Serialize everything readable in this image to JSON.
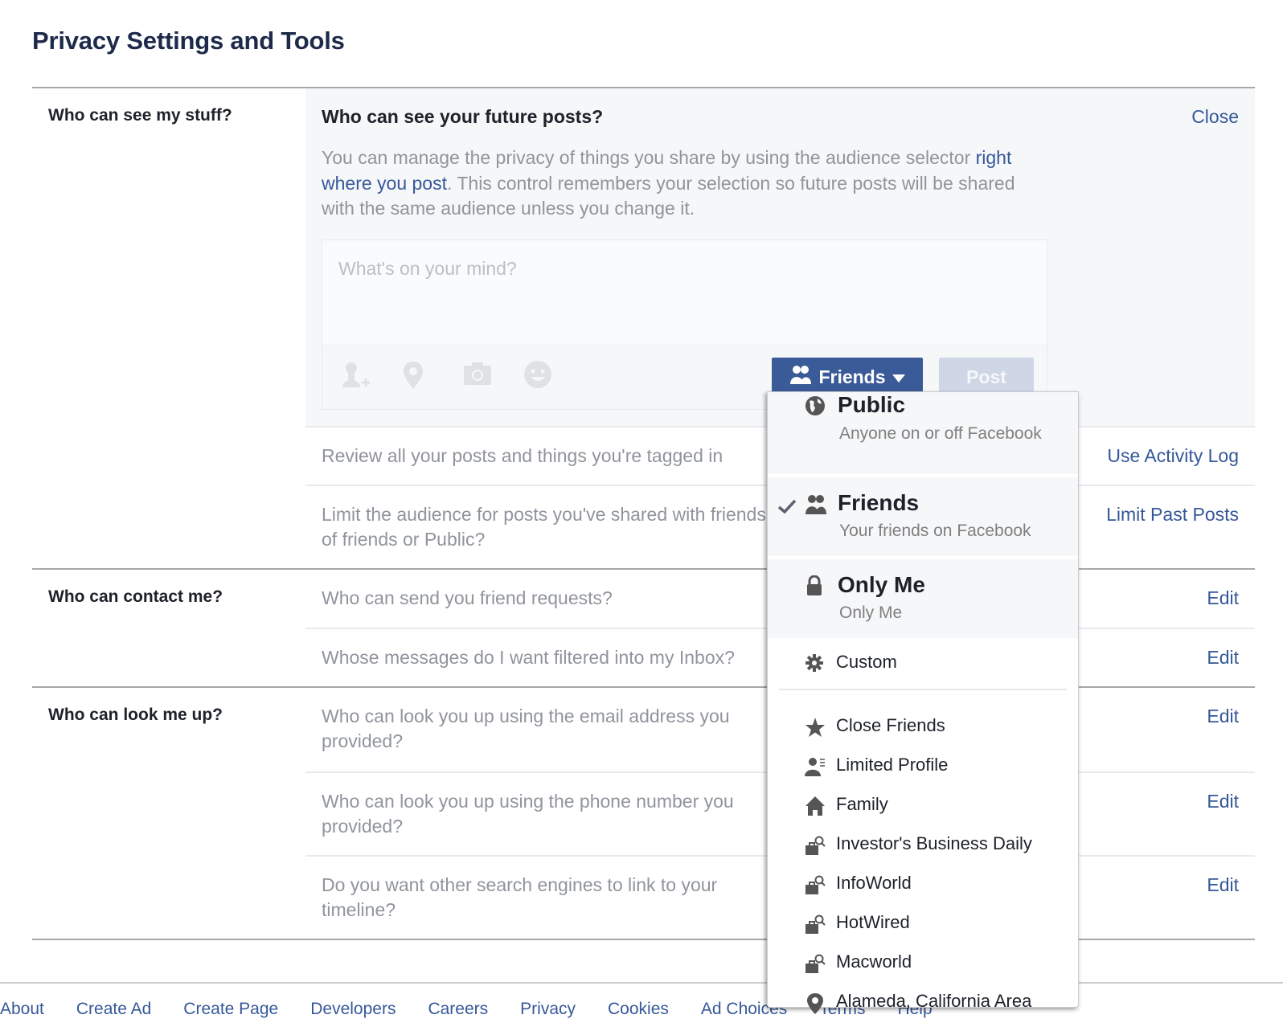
{
  "page": {
    "title": "Privacy Settings and Tools"
  },
  "colors": {
    "link": "#365899",
    "button": "#3b5a98",
    "muted_text": "#90949c",
    "panel_bg": "#f6f7f9"
  },
  "sections": [
    {
      "label": "Who can see my stuff?",
      "expanded": {
        "title": "Who can see your future posts?",
        "close_label": "Close",
        "description_before": "You can manage the privacy of things you share by using the audience selector ",
        "description_link": "right where you post",
        "description_after": ". This control remembers your selection so future posts will be shared with the same audience unless you change it.",
        "composer": {
          "placeholder": "What's on your mind?",
          "icons": [
            "tag-friends-icon",
            "location-pin-icon",
            "camera-icon",
            "smiley-icon"
          ],
          "audience_label": "Friends",
          "post_label": "Post"
        }
      },
      "rows": [
        {
          "text": "Review all your posts and things you're tagged in",
          "action": "Use Activity Log"
        },
        {
          "text": "Limit the audience for posts you've shared with friends of friends or Public?",
          "action": "Limit Past Posts"
        }
      ]
    },
    {
      "label": "Who can contact me?",
      "rows": [
        {
          "text": "Who can send you friend requests?",
          "action": "Edit"
        },
        {
          "text": "Whose messages do I want filtered into my Inbox?",
          "action": "Edit"
        }
      ]
    },
    {
      "label": "Who can look me up?",
      "rows": [
        {
          "text": "Who can look you up using the email address you provided?",
          "action": "Edit"
        },
        {
          "text": "Who can look you up using the phone number you provided?",
          "action": "Edit"
        },
        {
          "text": "Do you want other search engines to link to your timeline?",
          "action": "Edit"
        }
      ]
    }
  ],
  "audience_menu": {
    "selected": "Friends",
    "primary": [
      {
        "title": "Public",
        "subtitle": "Anyone on or off Facebook",
        "icon": "globe-icon"
      },
      {
        "title": "Friends",
        "subtitle": "Your friends on Facebook",
        "icon": "friends-icon",
        "checked": true
      },
      {
        "title": "Only Me",
        "subtitle": "Only Me",
        "icon": "lock-icon"
      }
    ],
    "custom": {
      "label": "Custom",
      "icon": "gear-icon"
    },
    "lists": [
      {
        "label": "Close Friends",
        "icon": "star-icon"
      },
      {
        "label": "Limited Profile",
        "icon": "limited-profile-icon"
      },
      {
        "label": "Family",
        "icon": "house-icon"
      },
      {
        "label": "Investor's Business Daily",
        "icon": "work-list-icon"
      },
      {
        "label": "InfoWorld",
        "icon": "work-list-icon"
      },
      {
        "label": "HotWired",
        "icon": "work-list-icon"
      },
      {
        "label": "Macworld",
        "icon": "work-list-icon"
      },
      {
        "label": "Alameda, California Area",
        "icon": "location-pin-icon"
      }
    ]
  },
  "footer": {
    "links": [
      "About",
      "Create Ad",
      "Create Page",
      "Developers",
      "Careers",
      "Privacy",
      "Cookies",
      "Ad Choices",
      "Terms",
      "Help"
    ]
  }
}
